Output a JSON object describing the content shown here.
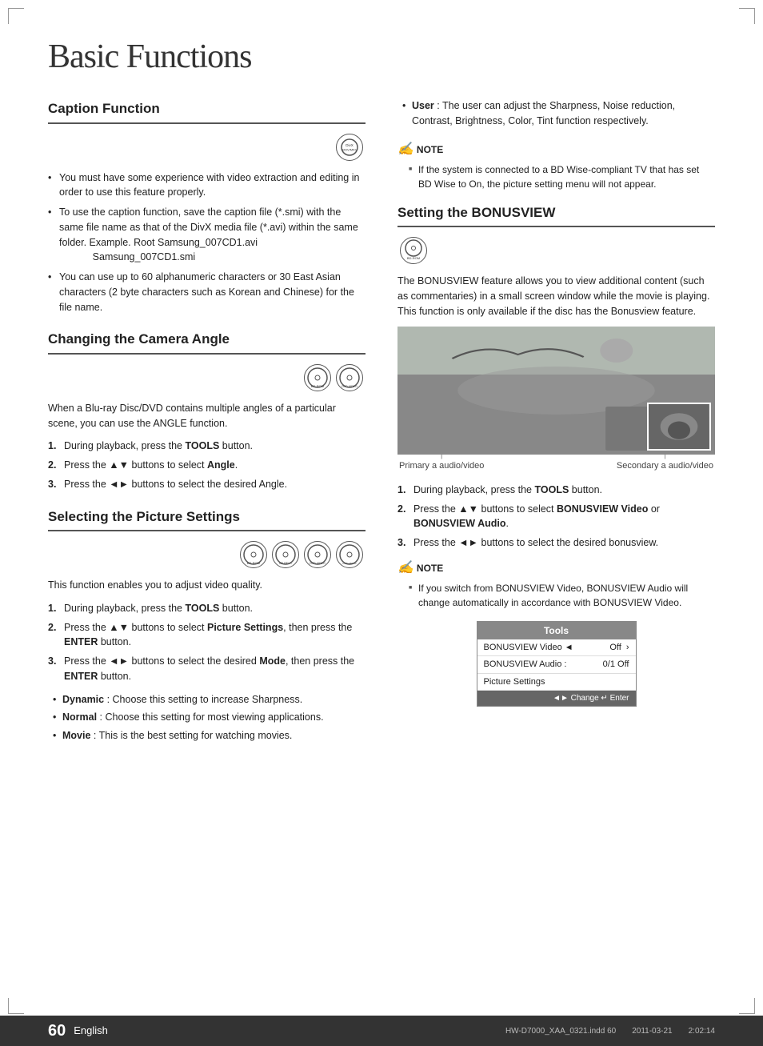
{
  "page": {
    "title": "Basic Functions",
    "page_number": "60",
    "language": "English",
    "footer_file": "HW-D7000_XAA_0321.indd   60",
    "footer_date": "2011-03-21",
    "footer_time": "2:02:14"
  },
  "left_column": {
    "caption_function": {
      "title": "Caption Function",
      "icon": "DivX/MOV/MKV",
      "bullets": [
        "You must have some experience with video extraction and editing in order to use this feature properly.",
        "To use the caption function, save the caption file (*.smi) with the same file name as that of the DivX media file (*.avi) within the same folder. Example. Root Samsung_007CD1.avi\n                Samsung_007CD1.smi",
        "You can use up to 60 alphanumeric characters or 30 East Asian characters (2 byte characters such as Korean and Chinese) for the file name."
      ]
    },
    "changing_camera_angle": {
      "title": "Changing the Camera Angle",
      "icons": [
        "BD-ROM",
        "DVD-VIDEO"
      ],
      "intro": "When a Blu-ray Disc/DVD contains multiple angles of a particular scene, you can use the ANGLE function.",
      "steps": [
        "During playback, press the TOOLS button.",
        "Press the ▲▼ buttons to select Angle.",
        "Press the ◄► buttons to select the desired Angle."
      ]
    },
    "selecting_picture_settings": {
      "title": "Selecting the Picture Settings",
      "icons": [
        "BD-ROM",
        "BD-RE/-R",
        "DVD-VIDEO",
        "DVD+RW/-R"
      ],
      "intro": "This function enables you to adjust video quality.",
      "steps": [
        "During playback, press the TOOLS button.",
        "Press the ▲▼ buttons to select Picture Settings, then press the ENTER button.",
        "Press the ◄► buttons to select the desired Mode, then press the ENTER button."
      ],
      "sub_bullets": [
        "Dynamic : Choose this setting to increase Sharpness.",
        "Normal : Choose this setting for most viewing applications.",
        "Movie : This is the best setting for watching movies.",
        "User : The user can adjust the Sharpness, Noise reduction, Contrast, Brightness, Color, Tint function respectively."
      ]
    }
  },
  "right_column": {
    "user_note_label": "User",
    "user_note_text": "The user can adjust the Sharpness, Noise reduction, Contrast, Brightness, Color, Tint function respectively.",
    "note1": {
      "title": "NOTE",
      "items": [
        "If the system is connected to a BD Wise-compliant TV that has set BD Wise to On, the picture setting menu will not appear."
      ]
    },
    "setting_bonusview": {
      "title": "Setting the BONUSVIEW",
      "icon": "BD-ROM",
      "intro": "The BONUSVIEW feature allows you to view additional content (such as commentaries) in a small screen window while the movie is playing. This function is only available if the disc has the Bonusview feature.",
      "primary_label": "Primary a audio/video",
      "secondary_label": "Secondary a audio/video",
      "steps": [
        "During playback, press the TOOLS button.",
        "Press the ▲▼ buttons to select BONUSVIEW Video or BONUSVIEW Audio.",
        "Press the ◄► buttons to select the desired bonusview."
      ],
      "note2": {
        "title": "NOTE",
        "items": [
          "If you switch from BONUSVIEW Video, BONUSVIEW Audio will change automatically in accordance with BONUSVIEW Video."
        ]
      },
      "tools_menu": {
        "header": "Tools",
        "rows": [
          {
            "label": "BONUSVIEW Video ◄",
            "value": "Off",
            "arrow": ">"
          },
          {
            "label": "BONUSVIEW Audio :",
            "value": "0/1 Off"
          },
          {
            "label": "Picture Settings",
            "value": ""
          }
        ],
        "footer": "◄► Change   ↵ Enter"
      }
    }
  }
}
